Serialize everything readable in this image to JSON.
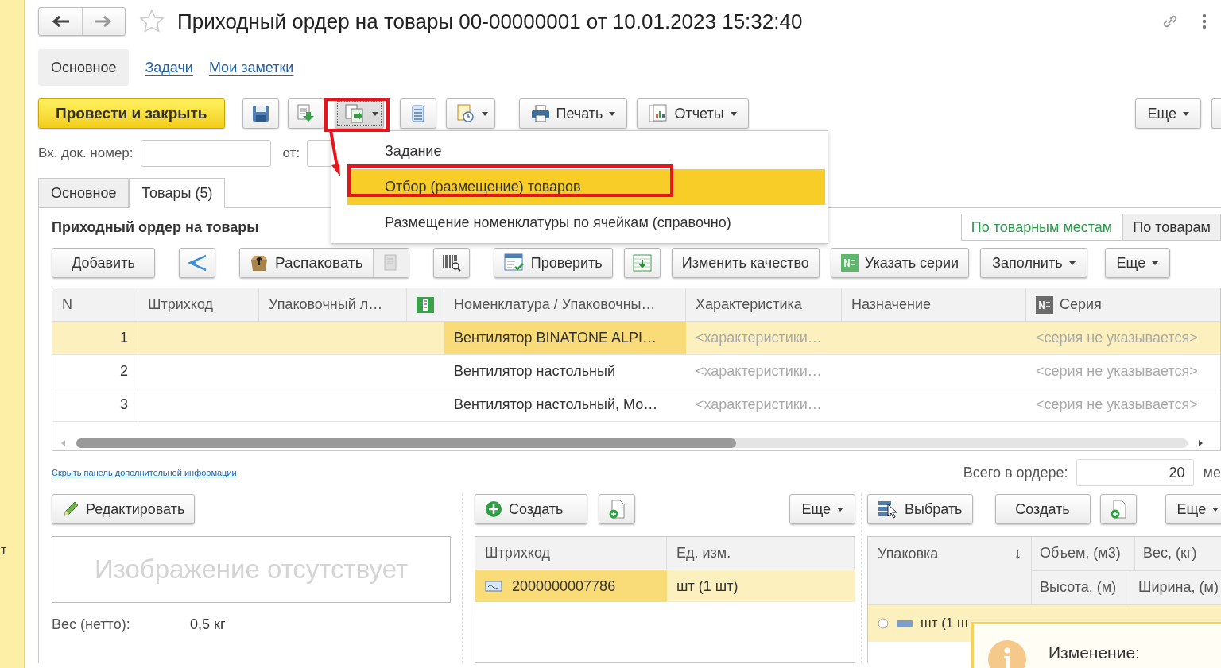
{
  "left_edge_text": "т",
  "window": {
    "title": "Приходный ордер на товары 00-00000001 от 10.01.2023 15:32:40",
    "favorite": false
  },
  "form_tabs": [
    {
      "label": "Основное",
      "selected": true
    },
    {
      "label": "Задачи",
      "selected": false
    },
    {
      "label": "Мои заметки",
      "selected": false
    }
  ],
  "toolbar": [
    {
      "kind": "primary",
      "label": "Провести и закрыть"
    },
    {
      "kind": "icon"
    },
    {
      "kind": "icon"
    },
    {
      "kind": "icon_menu",
      "expanded": true
    },
    {
      "kind": "icon"
    },
    {
      "kind": "icon_menu",
      "expanded": false
    },
    {
      "kind": "menu",
      "label": "Печать"
    },
    {
      "kind": "menu",
      "label": "Отчеты"
    }
  ],
  "toolbar_right": [
    {
      "kind": "menu",
      "label": "Еще"
    }
  ],
  "dropdown": [
    {
      "label": "Задание",
      "selected": false
    },
    {
      "label": "Отбор (размещение) товаров",
      "selected": true
    },
    {
      "label": "Размещение номенклатуры по ячейкам (справочно)",
      "selected": false
    }
  ],
  "incoming_number": {
    "label": "Вх. док. номер:"
  },
  "incoming_date": {
    "label": "от:"
  },
  "page_tabs": [
    {
      "label": "Основное",
      "selected": false
    },
    {
      "label": "Товары (5)",
      "selected": true
    }
  ],
  "section": {
    "title": "Приходный ордер на товары",
    "view_toggle": [
      {
        "label": "По товарным местам",
        "selected": true
      },
      {
        "label": "По товарам",
        "selected": false
      }
    ]
  },
  "table_toolbar": [
    {
      "kind": "button",
      "label": "Добавить"
    },
    {
      "kind": "icon"
    },
    {
      "kind": "split",
      "label": "Распаковать"
    },
    {
      "kind": "icon"
    },
    {
      "kind": "button",
      "label": "Проверить"
    },
    {
      "kind": "icon"
    },
    {
      "kind": "button",
      "label": "Изменить качество"
    },
    {
      "kind": "button",
      "label": "Указать серии"
    },
    {
      "kind": "menu",
      "label": "Заполнить"
    },
    {
      "kind": "menu",
      "label": "Еще"
    }
  ],
  "table": {
    "columns": [
      {
        "label": "N",
        "kind": "number"
      },
      {
        "label": "Штрихкод",
        "kind": "text"
      },
      {
        "label": "Упаковочный л…",
        "kind": "text"
      },
      {
        "kind": "icon"
      },
      {
        "label": "Номенклатура / Упаковочны…",
        "kind": "text"
      },
      {
        "label": "Характеристика",
        "kind": "hint"
      },
      {
        "label": "Назначение",
        "kind": "text"
      },
      {
        "label": "Серия",
        "kind": "hint"
      }
    ],
    "rows": [
      {
        "selected": true,
        "cells": [
          {
            "text": "1",
            "focused": false
          },
          {
            "focused": false
          },
          {
            "focused": false
          },
          {
            "focused": false
          },
          {
            "text": "Вентилятор BINATONE ALPI…",
            "focused": true
          },
          {
            "text": "<характеристики…",
            "focused": false
          },
          {
            "focused": false
          },
          {
            "text": "<серия не указывается>",
            "focused": false
          }
        ]
      },
      {
        "selected": false,
        "cells": [
          {
            "text": "2",
            "focused": false
          },
          {
            "focused": false
          },
          {
            "focused": false
          },
          {
            "focused": false
          },
          {
            "text": "Вентилятор настольный",
            "focused": false
          },
          {
            "text": "<характеристики…",
            "focused": false
          },
          {
            "focused": false
          },
          {
            "text": "<серия не указывается>",
            "focused": false
          }
        ]
      },
      {
        "selected": false,
        "cells": [
          {
            "text": "3",
            "focused": false
          },
          {
            "focused": false
          },
          {
            "focused": false
          },
          {
            "focused": false
          },
          {
            "text": "Вентилятор настольный, Мо…",
            "focused": false
          },
          {
            "text": "<характеристики…",
            "focused": false
          },
          {
            "focused": false
          },
          {
            "text": "<серия не указывается>",
            "focused": false
          }
        ]
      }
    ]
  },
  "hide_panel_link": "Скрыть панель дополнительной информации",
  "summary": {
    "label": "Всего в ордере:",
    "value": "20",
    "unit": "ме"
  },
  "details": {
    "edit_button": "Редактировать",
    "image_placeholder": "Изображение отсутствует",
    "properties": [
      {
        "label": "Вес (нетто):",
        "value": "0,5 кг"
      }
    ]
  },
  "barcodes": {
    "toolbar": [
      {
        "kind": "create",
        "label": "Создать"
      },
      {
        "kind": "icon"
      },
      {
        "kind": "menu",
        "label": "Еще"
      }
    ],
    "columns": [
      "Штрихкод",
      "Ед. изм."
    ],
    "rows": [
      {
        "selected": true,
        "cells": [
          "2000000007786",
          "шт (1 шт)"
        ]
      }
    ]
  },
  "packages": {
    "toolbar": [
      {
        "kind": "select",
        "label": "Выбрать"
      },
      {
        "kind": "button",
        "label": "Создать"
      },
      {
        "kind": "icon"
      },
      {
        "kind": "menu",
        "label": "Еще"
      }
    ],
    "sort_column": {
      "label": "Упаковка",
      "sort": "↓"
    },
    "columns_top": [
      "Объем, (м3)",
      "Вес, (кг)"
    ],
    "columns_bottom": [
      "Высота, (м)",
      "Ширина, (м)"
    ],
    "rows": [
      {
        "selected": false,
        "text": "шт (1 ш"
      }
    ]
  },
  "notification": {
    "text": "Изменение:"
  }
}
